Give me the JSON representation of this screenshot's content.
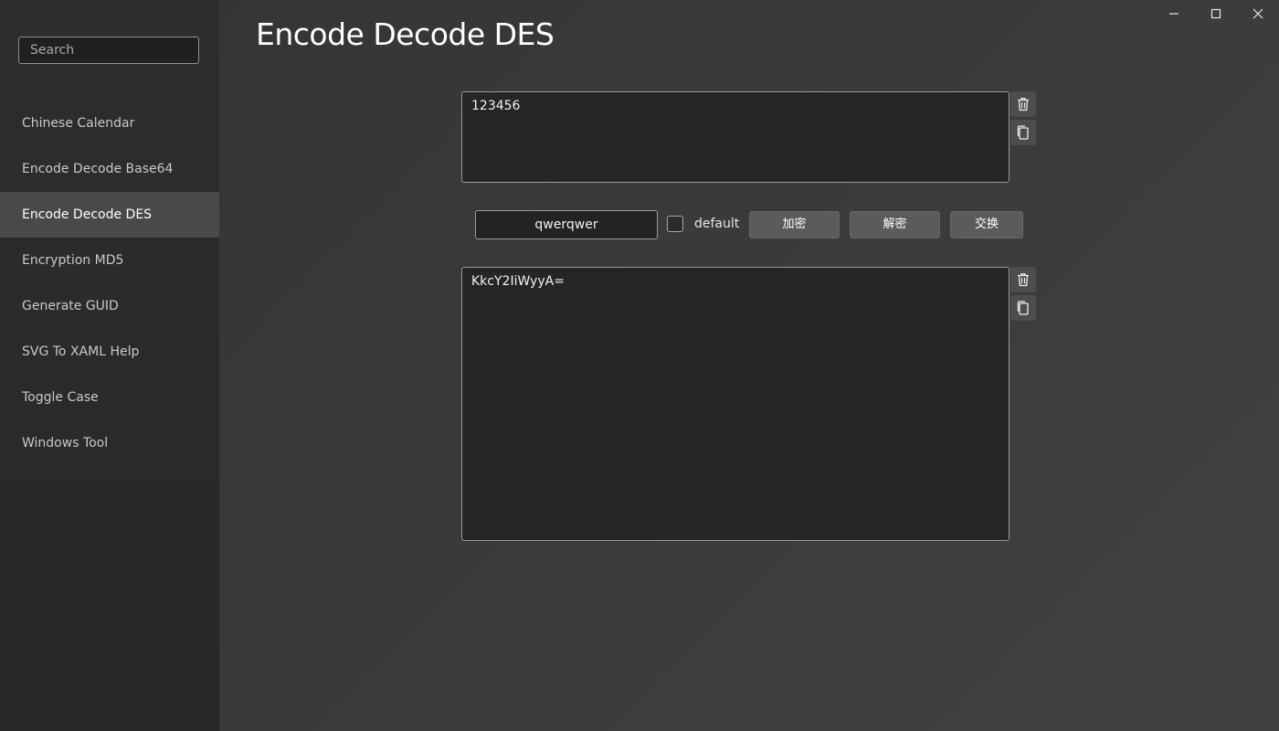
{
  "sidebar": {
    "search_placeholder": "Search",
    "items": [
      {
        "label": "Chinese Calendar"
      },
      {
        "label": "Encode Decode Base64"
      },
      {
        "label": "Encode Decode DES"
      },
      {
        "label": "Encryption MD5"
      },
      {
        "label": "Generate GUID"
      },
      {
        "label": "SVG To XAML Help"
      },
      {
        "label": "Toggle Case"
      },
      {
        "label": "Windows Tool"
      }
    ],
    "active_index": 2
  },
  "window_controls": {
    "icons": [
      "minimize-icon",
      "maximize-icon",
      "close-icon"
    ]
  },
  "page": {
    "title": "Encode Decode DES",
    "input_text": "123456",
    "output_text": "KkcY2IiWyyA=",
    "key_value": "qwerqwer",
    "default_checked": false,
    "default_label": "default",
    "encrypt_label": "加密",
    "decrypt_label": "解密",
    "swap_label": "交换"
  },
  "colors": {
    "background": "#3a3b3b",
    "sidebar": "#2a2b2b",
    "active_item": "#484949",
    "button": "#5a5b5b"
  }
}
